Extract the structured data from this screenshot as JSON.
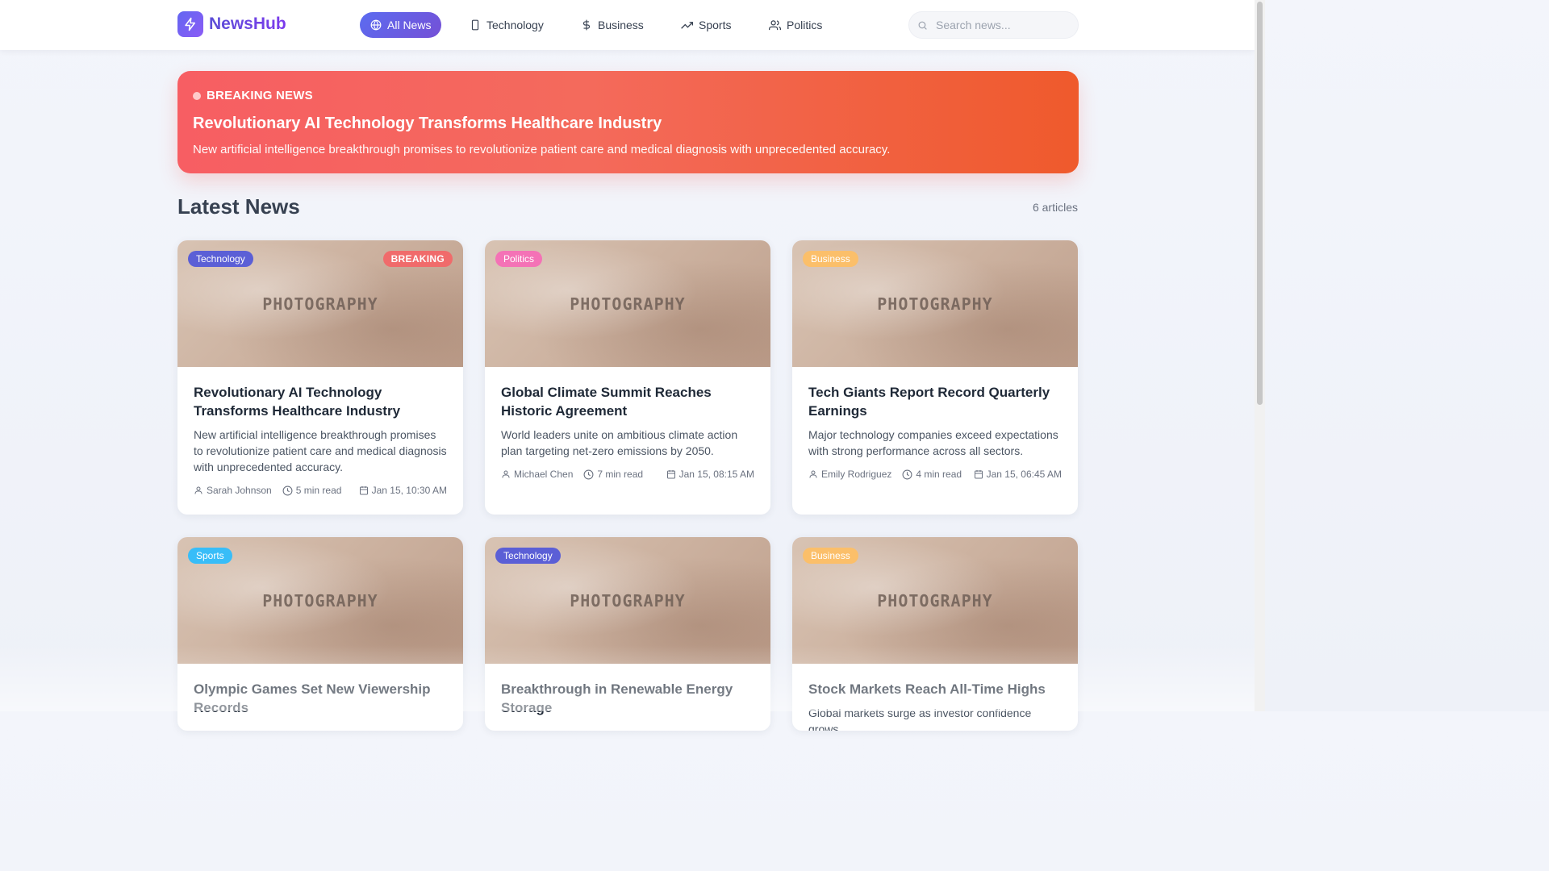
{
  "app": {
    "name": "NewsHub"
  },
  "nav": [
    {
      "label": "All News",
      "icon": "globe-icon",
      "active": true
    },
    {
      "label": "Technology",
      "icon": "smartphone-icon",
      "active": false
    },
    {
      "label": "Business",
      "icon": "dollar-icon",
      "active": false
    },
    {
      "label": "Sports",
      "icon": "trending-up-icon",
      "active": false
    },
    {
      "label": "Politics",
      "icon": "users-icon",
      "active": false
    }
  ],
  "search": {
    "placeholder": "Search news...",
    "value": ""
  },
  "breaking": {
    "label": "BREAKING NEWS",
    "title": "Revolutionary AI Technology Transforms Healthcare Industry",
    "description": "New artificial intelligence breakthrough promises to revolutionize patient care and medical diagnosis with unprecedented accuracy."
  },
  "section": {
    "title": "Latest News",
    "count": "6 articles"
  },
  "image_caption": "PHOTOGRAPHY",
  "breaking_badge": "BREAKING",
  "category_colors": {
    "Technology": "#5b5fd6",
    "Politics": "#f472b6",
    "Business": "#fbbf6a",
    "Sports": "#38bdf8"
  },
  "articles": [
    {
      "category": "Technology",
      "breaking": true,
      "title": "Revolutionary AI Technology Transforms Healthcare Industry",
      "description": "New artificial intelligence breakthrough promises to revolutionize patient care and medical diagnosis with unprecedented accuracy.",
      "author": "Sarah Johnson",
      "read_time": "5 min read",
      "date": "Jan 15, 10:30 AM"
    },
    {
      "category": "Politics",
      "breaking": false,
      "title": "Global Climate Summit Reaches Historic Agreement",
      "description": "World leaders unite on ambitious climate action plan targeting net-zero emissions by 2050.",
      "author": "Michael Chen",
      "read_time": "7 min read",
      "date": "Jan 15, 08:15 AM"
    },
    {
      "category": "Business",
      "breaking": false,
      "title": "Tech Giants Report Record Quarterly Earnings",
      "description": "Major technology companies exceed expectations with strong performance across all sectors.",
      "author": "Emily Rodriguez",
      "read_time": "4 min read",
      "date": "Jan 15, 06:45 AM"
    },
    {
      "category": "Sports",
      "breaking": false,
      "title": "Olympic Games Set New Viewership Records",
      "description": "",
      "author": "",
      "read_time": "",
      "date": ""
    },
    {
      "category": "Technology",
      "breaking": false,
      "title": "Breakthrough in Renewable Energy Storage",
      "description": "",
      "author": "",
      "read_time": "",
      "date": ""
    },
    {
      "category": "Business",
      "breaking": false,
      "title": "Stock Markets Reach All-Time Highs",
      "description": "Global markets surge as investor confidence grows",
      "author": "",
      "read_time": "",
      "date": ""
    }
  ]
}
